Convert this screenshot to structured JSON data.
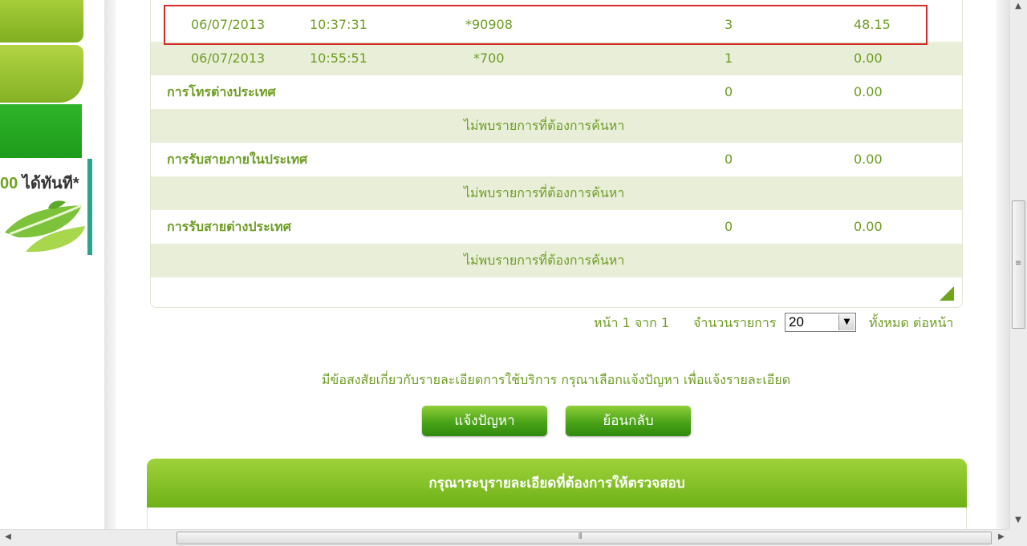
{
  "sidebar": {
    "promo_number": "00",
    "promo_text": " ได้ทันที*"
  },
  "table": {
    "rows": [
      {
        "date": "06/07/2013",
        "time": "10:37:31",
        "number": "*90908",
        "count": "3",
        "amount": "48.15"
      },
      {
        "date": "06/07/2013",
        "time": "10:55:51",
        "number": "*700",
        "count": "1",
        "amount": "0.00"
      }
    ],
    "sections": [
      {
        "title": "การโทรต่างประเทศ",
        "count": "0",
        "amount": "0.00",
        "empty_message": "ไม่พบรายการที่ต้องการค้นหา"
      },
      {
        "title": "การรับสายภายในประเทศ",
        "count": "0",
        "amount": "0.00",
        "empty_message": "ไม่พบรายการที่ต้องการค้นหา"
      },
      {
        "title": "การรับสายต่างประเทศ",
        "count": "0",
        "amount": "0.00",
        "empty_message": "ไม่พบรายการที่ต้องการค้นหา"
      }
    ]
  },
  "pager": {
    "page_label": "หน้า 1 จาก 1",
    "items_label": "จำนวนรายการ",
    "page_size": "20",
    "all_per_page": "ทั้งหมด ต่อหน้า"
  },
  "question_text": "มีข้อสงสัยเกี่ยวกับรายละเอียดการใช้บริการ กรุณาเลือกแจ้งปัญหา เพื่อแจ้งรายละเอียด",
  "buttons": {
    "report": "แจ้งปัญหา",
    "back": "ย้อนกลับ"
  },
  "form_header": "กรุณาระบุรายละเอียดที่ต้องการให้ตรวจสอบ",
  "colors": {
    "text_green": "#6e9d24",
    "row_shade": "#e9eed9",
    "highlight_red": "#d42b2b",
    "button_green": "#4aa317"
  }
}
